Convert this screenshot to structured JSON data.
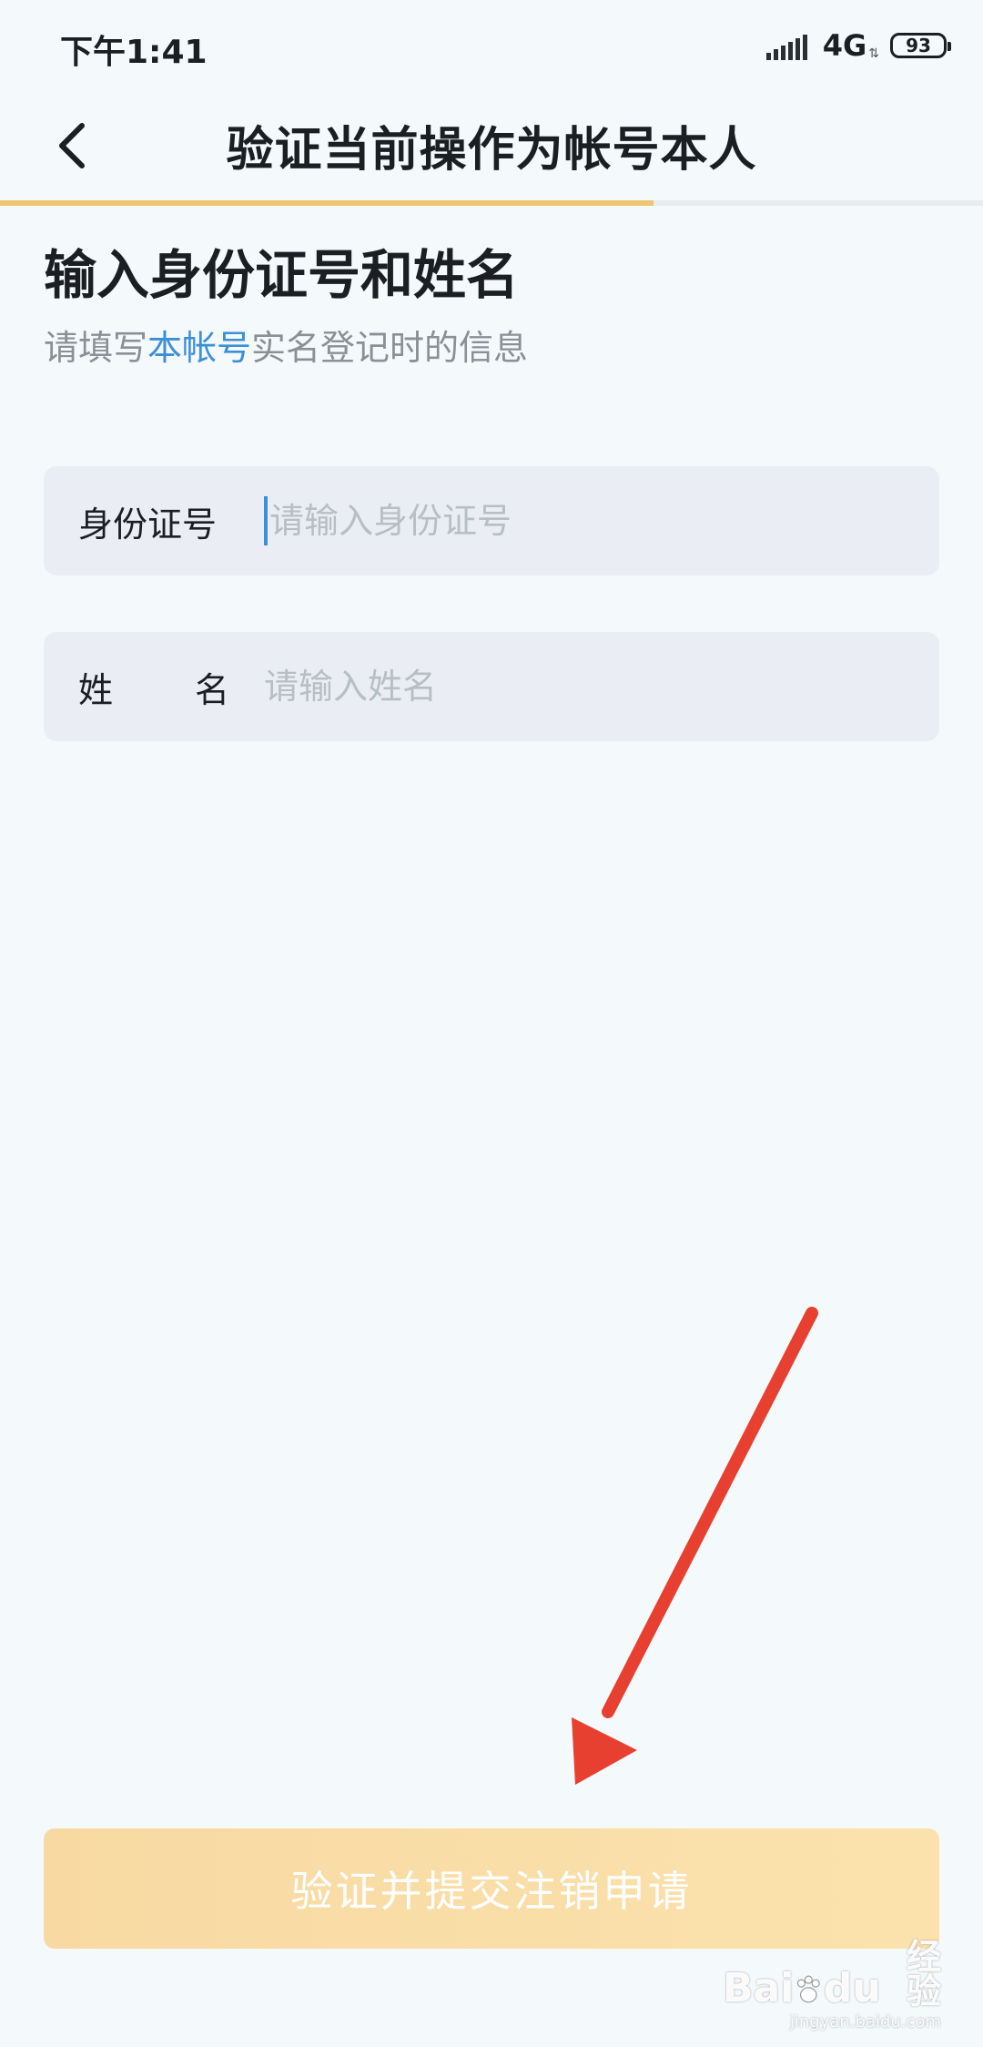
{
  "status_bar": {
    "time": "下午1:41",
    "network": "4G",
    "battery": "93",
    "signal_icon": "signal-bars-icon",
    "battery_icon": "battery-icon"
  },
  "nav": {
    "back_icon": "chevron-left-icon",
    "title": "验证当前操作为帐号本人"
  },
  "progress": {
    "fraction": 0.665,
    "fill_color": "#f0c470"
  },
  "content": {
    "heading": "输入身份证号和姓名",
    "subtitle_prefix": "请填写",
    "subtitle_highlight": "本帐号",
    "subtitle_suffix": "实名登记时的信息",
    "highlight_color": "#3d8fd6"
  },
  "form": {
    "id_label": "身份证号",
    "id_placeholder": "请输入身份证号",
    "id_value": "",
    "name_label_first": "姓",
    "name_label_second": "名",
    "name_placeholder": "请输入姓名",
    "name_value": ""
  },
  "submit": {
    "label": "验证并提交注销申请"
  },
  "annotation": {
    "icon": "red-arrow-icon",
    "color": "#e84030"
  },
  "watermark": {
    "main_left": "Bai",
    "main_right": "du",
    "main_cn": "经验",
    "sub": "jingyan.baidu.com"
  }
}
